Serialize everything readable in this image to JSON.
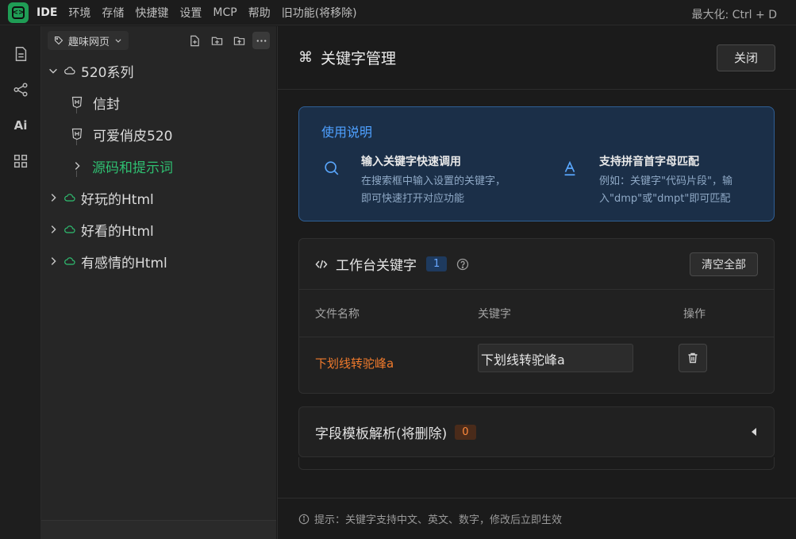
{
  "menubar": {
    "title": "IDE",
    "items": [
      "环境",
      "存储",
      "快捷键",
      "设置",
      "MCP",
      "帮助",
      "旧功能(将移除)"
    ],
    "right": "最大化: Ctrl + D"
  },
  "activity": {
    "ai_label": "Ai"
  },
  "explorer": {
    "workspace": "趣味网页",
    "tree": {
      "root": "520系列",
      "children": [
        "信封",
        "可爱俏皮520",
        "源码和提示词"
      ],
      "folders": [
        "好玩的Html",
        "好看的Html",
        "有感情的Html"
      ]
    }
  },
  "main": {
    "title": "关键字管理",
    "close_label": "关闭",
    "usage": {
      "title": "使用说明",
      "col1_title": "输入关键字快速调用",
      "col1_desc": "在搜索框中输入设置的关键字，即可快速打开对应功能",
      "col2_title": "支持拼音首字母匹配",
      "col2_desc": "例如：关键字\"代码片段\"，输入\"dmp\"或\"dmpt\"即可匹配"
    },
    "workspace_card": {
      "title": "工作台关键字",
      "count": "1",
      "clear_label": "清空全部",
      "columns": [
        "文件名称",
        "关键字",
        "操作"
      ],
      "rows": [
        {
          "file": "下划线转驼峰a",
          "keyword": "下划线转驼峰a"
        }
      ]
    },
    "field_card": {
      "title": "字段模板解析(将删除)",
      "count": "0"
    },
    "tip": "提示：关键字支持中文、英文、数字，修改后立即生效"
  },
  "colors": {
    "accent_green": "#2fbf71",
    "accent_blue": "#4ea0ff",
    "accent_orange": "#f07a2c"
  }
}
